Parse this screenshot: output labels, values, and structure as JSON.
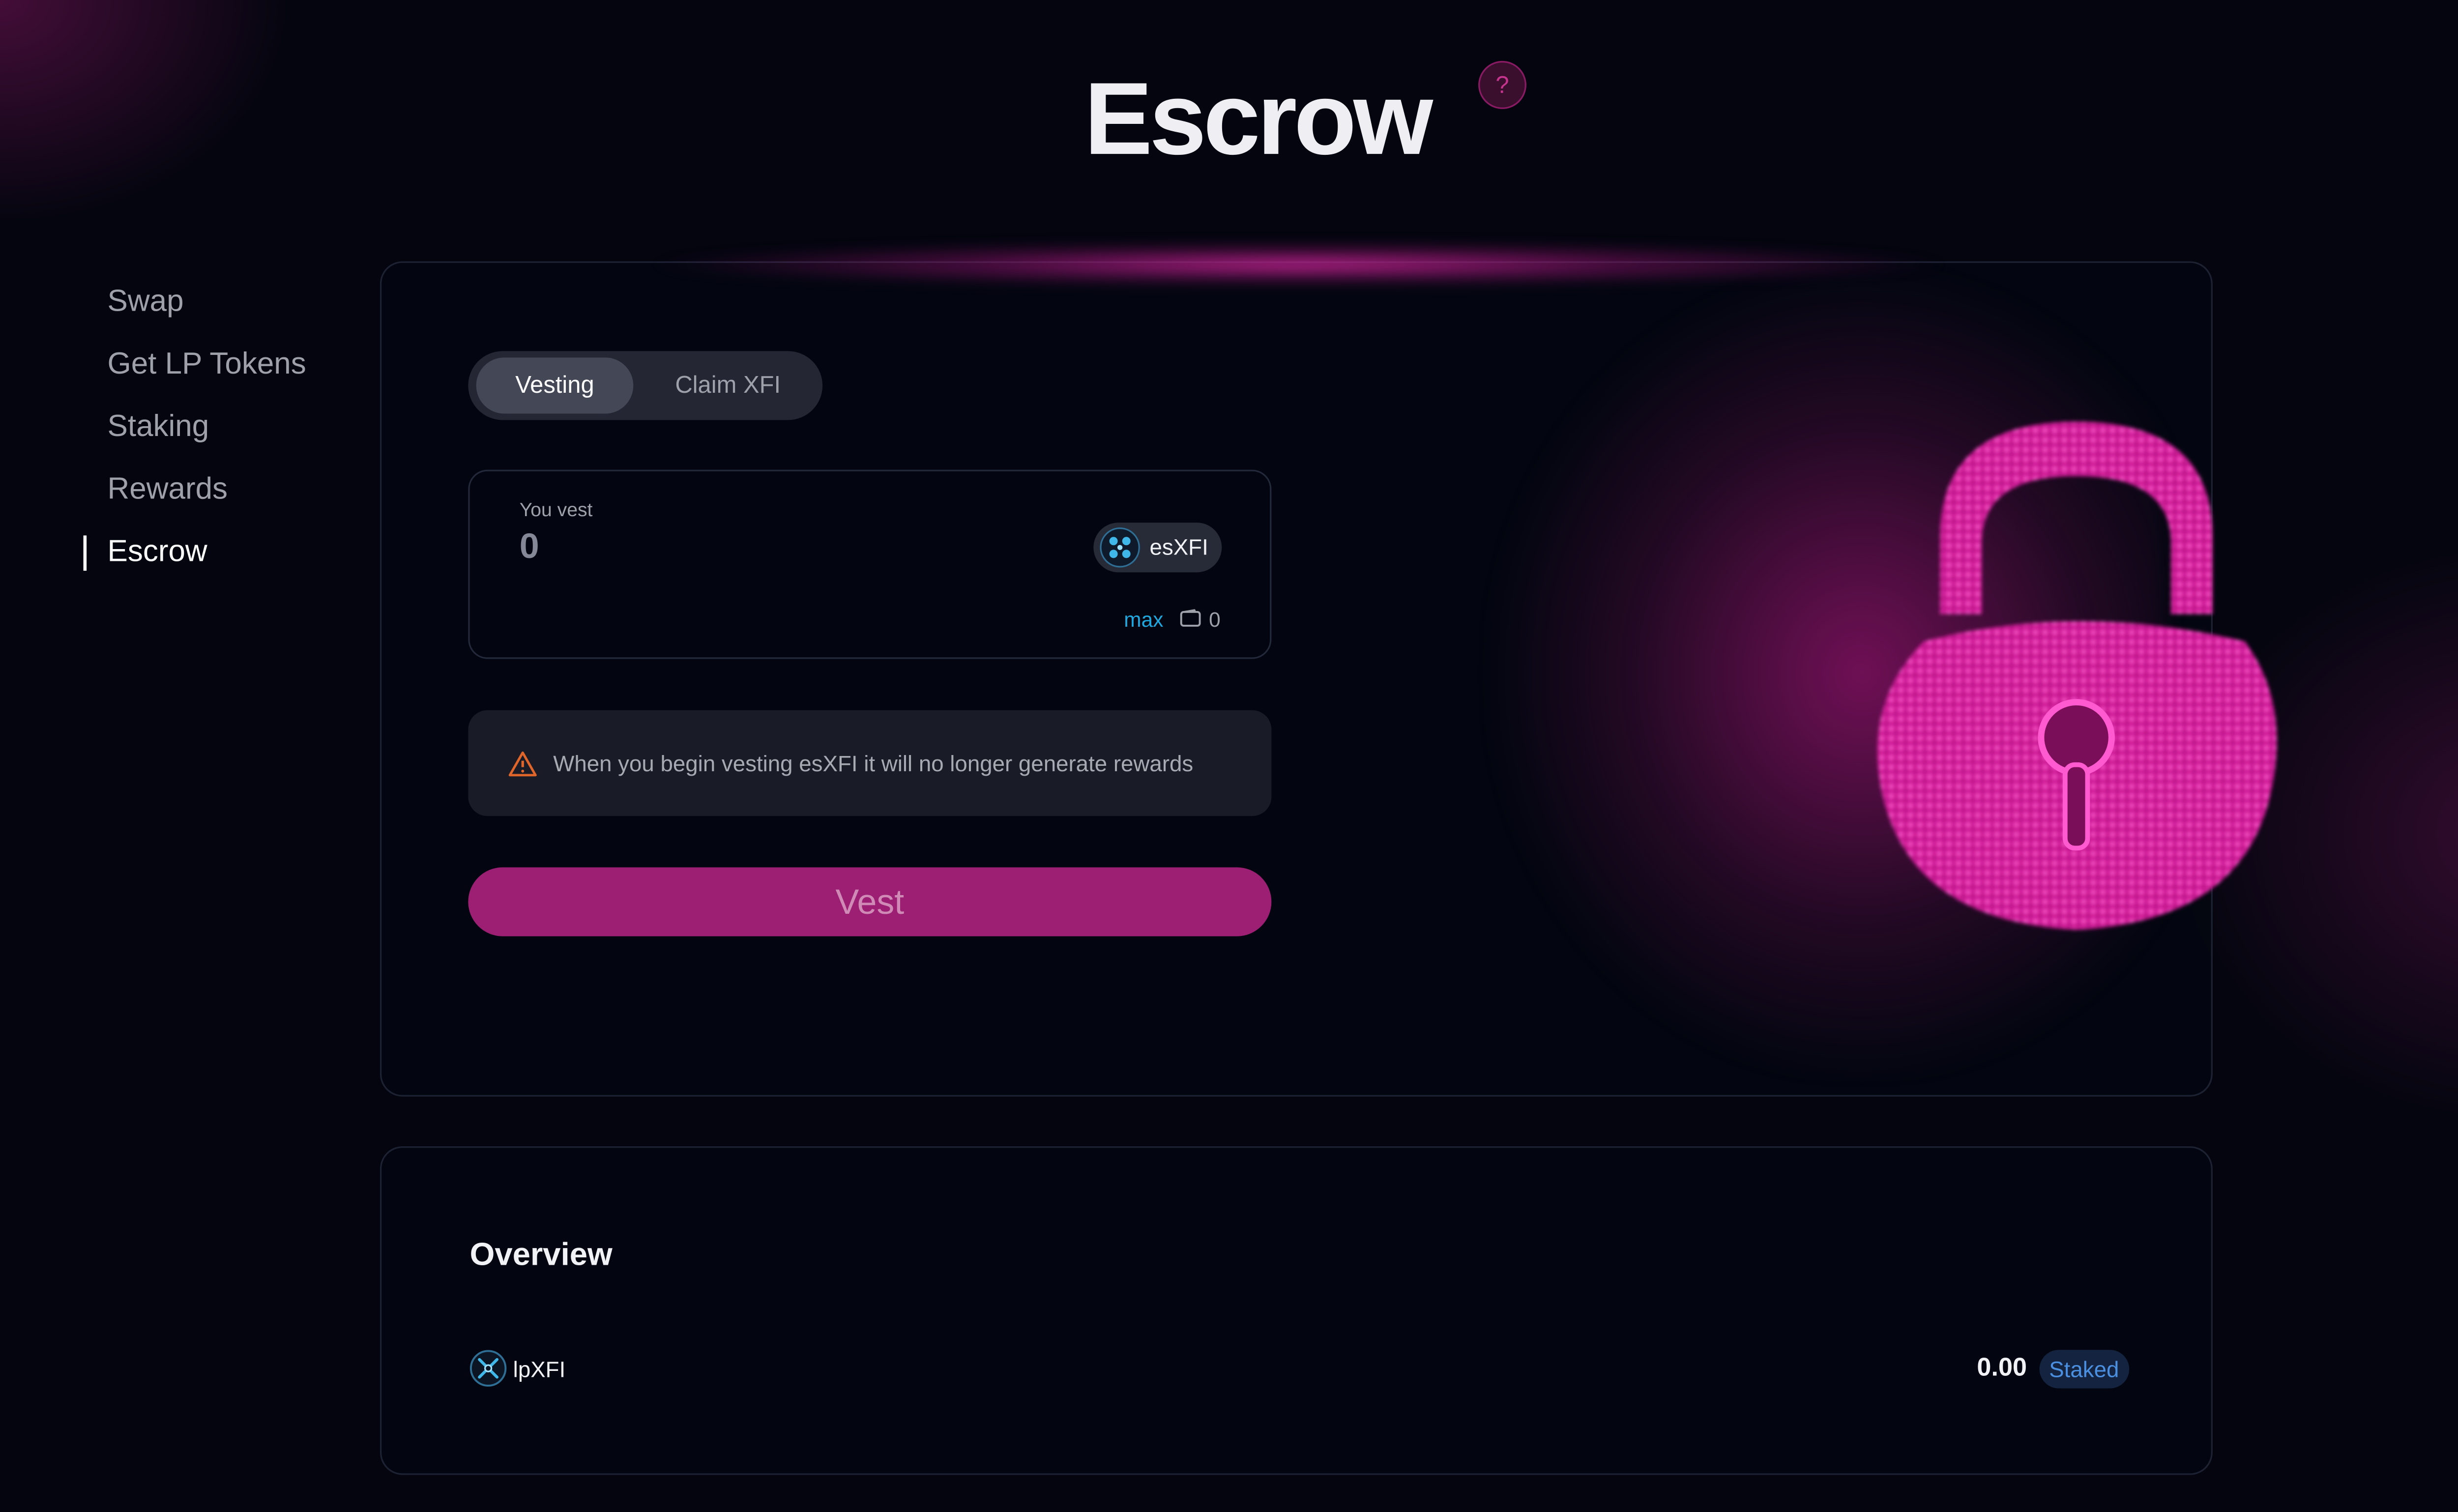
{
  "page": {
    "title": "Escrow",
    "help_label": "?"
  },
  "sidebar": {
    "items": [
      {
        "label": "Swap",
        "active": false
      },
      {
        "label": "Get LP Tokens",
        "active": false
      },
      {
        "label": "Staking",
        "active": false
      },
      {
        "label": "Rewards",
        "active": false
      },
      {
        "label": "Escrow",
        "active": true
      }
    ]
  },
  "tabs": {
    "vesting_label": "Vesting",
    "claim_label": "Claim XFI",
    "selected": "Vesting"
  },
  "vest_input": {
    "label": "You vest",
    "value": "0",
    "token": "esXFI",
    "token_icon": "xfi-token-icon",
    "max_label": "max",
    "balance_icon": "wallet-icon",
    "balance": "0"
  },
  "warning": {
    "icon": "warning-triangle-icon",
    "text": "When you begin vesting esXFI it will no longer generate rewards"
  },
  "vest_button": {
    "label": "Vest"
  },
  "overview": {
    "title": "Overview",
    "rows": [
      {
        "token": "lpXFI",
        "icon": "lpxfi-token-icon",
        "amount": "0.00",
        "status": "Staked"
      }
    ]
  },
  "illustration": {
    "icon": "padlock-icon"
  },
  "colors": {
    "background": "#04050f",
    "accent": "#9c1f73",
    "glow": "#d728a0",
    "link": "#1fa8e0",
    "badge_text": "#4a8fe0",
    "warning": "#e0652a"
  }
}
